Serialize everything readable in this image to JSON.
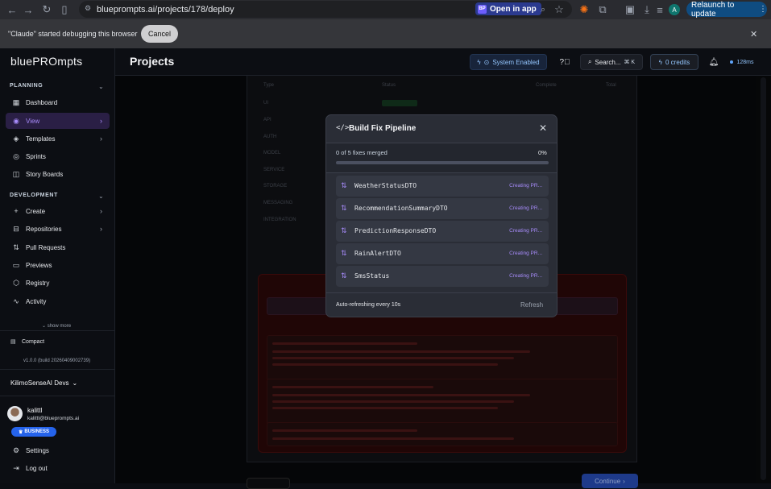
{
  "browser": {
    "url": "blueprompts.ai/projects/178/deploy",
    "open_in_app": "Open in app",
    "open_in_app_badge": "BP",
    "relaunch": "Relaunch to update",
    "profile_initial": "A"
  },
  "debug_bar": {
    "message": "\"Claude\" started debugging this browser",
    "cancel": "Cancel"
  },
  "sidebar": {
    "brand": "bluePROmpts",
    "planning_header": "PLANNING",
    "planning_items": [
      {
        "label": "Dashboard",
        "icon": "dashboard-icon"
      },
      {
        "label": "View",
        "icon": "eye-icon",
        "active": true
      },
      {
        "label": "Templates",
        "icon": "templates-icon"
      },
      {
        "label": "Sprints",
        "icon": "sprints-icon"
      },
      {
        "label": "Story Boards",
        "icon": "storyboard-icon"
      }
    ],
    "development_header": "DEVELOPMENT",
    "development_items": [
      {
        "label": "Create",
        "icon": "plus-icon"
      },
      {
        "label": "Repositories",
        "icon": "repositories-icon"
      },
      {
        "label": "Pull Requests",
        "icon": "pull-request-icon"
      },
      {
        "label": "Previews",
        "icon": "previews-icon"
      },
      {
        "label": "Registry",
        "icon": "registry-icon"
      },
      {
        "label": "Activity",
        "icon": "activity-icon"
      }
    ],
    "show_more": "show more",
    "compact": "Compact",
    "version": "v1.0.0 (build 20260409002739)",
    "org": "KilimoSenseAI Devs",
    "user_name": "kalittl",
    "user_email": "kalittl@blueprompts.ai",
    "plan_badge": "BUSINESS",
    "settings": "Settings",
    "logout": "Log out"
  },
  "header": {
    "title": "Projects",
    "system_status": "System Enabled",
    "search": "Search...",
    "search_shortcut": "⌘ K",
    "credits": "0 credits",
    "latency": "128ms"
  },
  "background_table": {
    "headers": [
      "Type",
      "Status",
      "Complete",
      "Total"
    ],
    "rows": [
      "UI",
      "API",
      "AUTH",
      "MODEL",
      "SERVICE",
      "STORAGE",
      "MESSAGING",
      "INTEGRATION"
    ]
  },
  "continue_button": "Continue",
  "modal": {
    "title": "Build Fix Pipeline",
    "progress_label": "0 of 5 fixes merged",
    "progress_percent": "0%",
    "progress_value": 0,
    "fixes": [
      {
        "name": "WeatherStatusDTO",
        "status": "Creating PR..."
      },
      {
        "name": "RecommendationSummaryDTO",
        "status": "Creating PR..."
      },
      {
        "name": "PredictionResponseDTO",
        "status": "Creating PR..."
      },
      {
        "name": "RainAlertDTO",
        "status": "Creating PR..."
      },
      {
        "name": "SmsStatus",
        "status": "Creating PR..."
      }
    ],
    "auto_refresh": "Auto-refreshing every 10s",
    "refresh": "Refresh"
  },
  "colors": {
    "accent_purple": "#a78bfa",
    "accent_blue": "#60a5fa",
    "relaunch_bg": "#0f4c81"
  }
}
